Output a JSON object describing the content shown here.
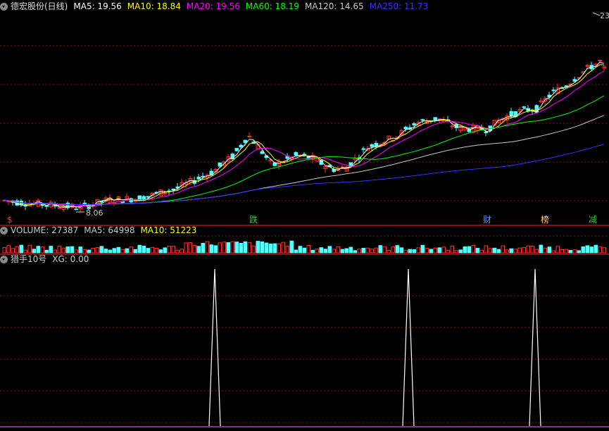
{
  "main_chart": {
    "title": "德宏股份(日线)",
    "indicators": [
      {
        "label": "MA5: 19.56",
        "color": "#ffffff"
      },
      {
        "label": "MA10: 18.84",
        "color": "#ffff00"
      },
      {
        "label": "MA20: 19.56",
        "color": "#ff00ff"
      },
      {
        "label": "MA60: 18.19",
        "color": "#00ff00"
      },
      {
        "label": "MA120: 14.65",
        "color": "#c8c8c8"
      },
      {
        "label": "MA250: 11.73",
        "color": "#3333ff"
      }
    ],
    "high_label": "23",
    "low_label": "8.06",
    "event_tags": [
      {
        "text": "$",
        "color": "#ff3333"
      },
      {
        "text": "跌",
        "color": "#33cc33"
      },
      {
        "text": "财",
        "color": "#5599ff"
      },
      {
        "text": "榜",
        "color": "#ffcc66"
      },
      {
        "text": "减",
        "color": "#33cc33"
      }
    ]
  },
  "volume_panel": {
    "indicators": [
      {
        "label": "VOLUME: 27387",
        "color": "#c8c8c8"
      },
      {
        "label": "MA5: 64998",
        "color": "#c8c8c8"
      },
      {
        "label": "MA10: 51223",
        "color": "#ffff00"
      }
    ]
  },
  "signal_panel": {
    "name": "猎手10号",
    "xg_label": "XG: 0.00"
  },
  "colors": {
    "up": "#ff3333",
    "down": "#54ffff",
    "grid": "#8a1010"
  }
}
